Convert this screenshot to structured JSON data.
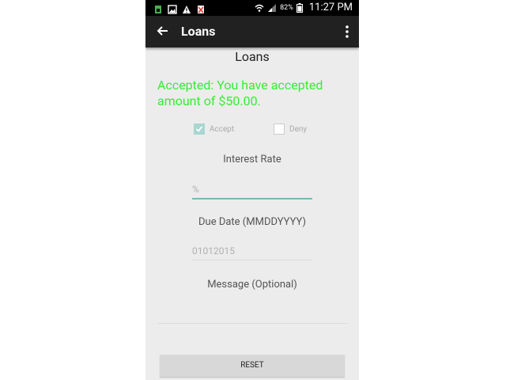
{
  "status_bar": {
    "battery_percent": "82%",
    "time": "11:27 PM",
    "icons": [
      "sim-icon",
      "gallery-icon",
      "warning-icon",
      "no-sd-icon",
      "wifi-icon",
      "signal-icon",
      "battery-icon"
    ]
  },
  "toolbar": {
    "title": "Loans",
    "back_icon": "arrow-left-icon",
    "menu_icon": "overflow-menu-icon"
  },
  "screen": {
    "title": "Loans",
    "status_message": "Accepted: You have accepted amount of $50.00.",
    "status_color": "#33ee33"
  },
  "options": {
    "accept_label": "Accept",
    "accept_checked": true,
    "deny_label": "Deny",
    "deny_checked": false
  },
  "interest": {
    "label": "Interest Rate",
    "placeholder": "%"
  },
  "due_date": {
    "label": "Due Date (MMDDYYYY)",
    "placeholder": "01012015"
  },
  "message": {
    "label": "Message (Optional)",
    "value": ""
  },
  "buttons": {
    "reset_label": "RESET"
  },
  "colors": {
    "toolbar": "#212121",
    "background": "#ececec",
    "accent": "#7ab8b0"
  }
}
